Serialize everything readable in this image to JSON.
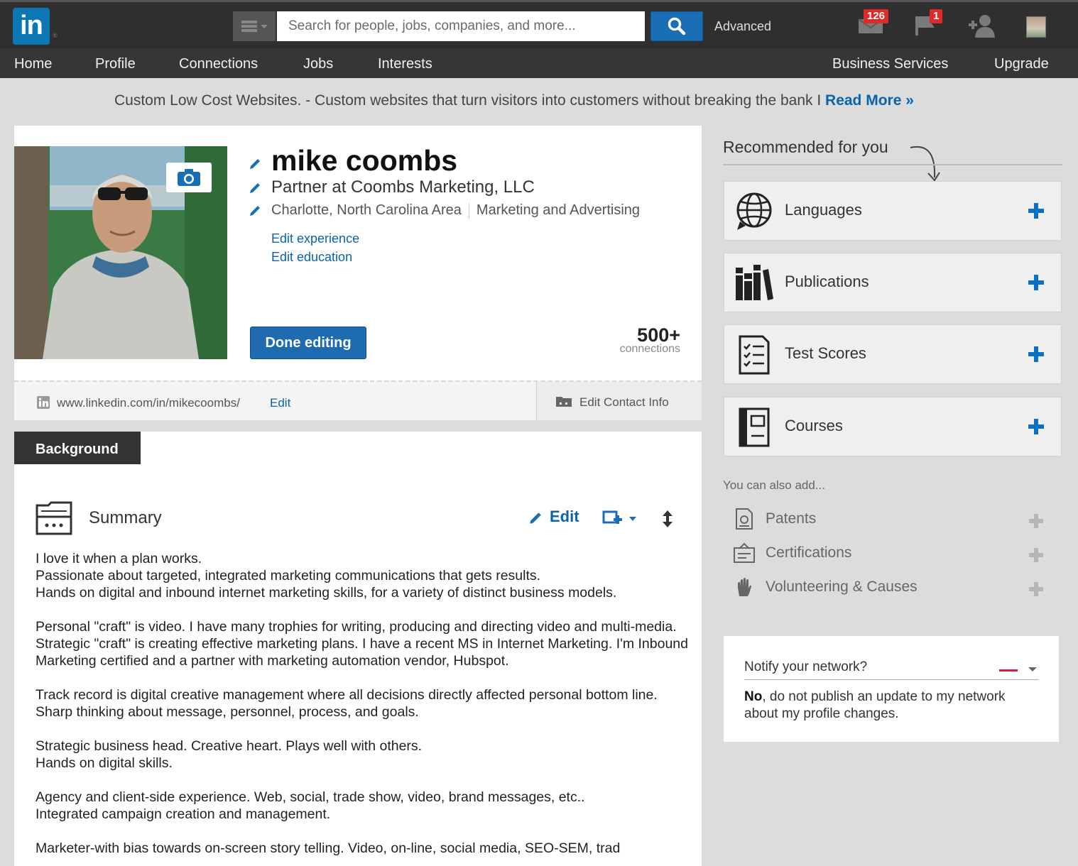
{
  "topbar": {
    "logo_text": "in",
    "logo_tm": "®",
    "search_placeholder": "Search for people, jobs, companies, and more...",
    "advanced_label": "Advanced",
    "messages_badge": "126",
    "notifications_badge": "1"
  },
  "nav": {
    "items": [
      "Home",
      "Profile",
      "Connections",
      "Jobs",
      "Interests"
    ],
    "right_items": [
      "Business Services",
      "Upgrade"
    ]
  },
  "ad": {
    "text": "Custom Low Cost Websites. - Custom websites that turn visitors into customers without breaking the bank I ",
    "link": "Read More »"
  },
  "profile": {
    "name": "mike coombs",
    "headline": "Partner at Coombs Marketing, LLC",
    "location": "Charlotte, North Carolina Area",
    "industry": "Marketing and Advertising",
    "edit_experience": "Edit experience",
    "edit_education": "Edit education",
    "done_button": "Done editing",
    "connections_count": "500+",
    "connections_label": "connections",
    "public_url": "www.linkedin.com/in/mikecoombs/",
    "url_edit": "Edit",
    "edit_contact": "Edit Contact Info"
  },
  "background": {
    "tab_label": "Background",
    "summary_title": "Summary",
    "summary_edit": "Edit",
    "paragraphs": [
      "I love it when a plan works.\nPassionate about targeted, integrated marketing communications that gets results.\nHands on digital and inbound internet marketing skills, for a variety of distinct business models.",
      "Personal \"craft\" is video. I have many trophies for writing, producing and directing video and multi-media. Strategic \"craft\" is creating effective marketing plans. I have a recent MS in Internet Marketing. I'm Inbound Marketing certified and a partner with marketing automation vendor, Hubspot.",
      "Track record is digital creative management where all decisions directly affected personal bottom line. Sharp thinking about message, personnel, process, and goals.",
      "Strategic business head. Creative heart. Plays well with others.\nHands on digital skills.",
      "Agency and client-side experience. Web, social, trade show, video, brand messages, etc..\nIntegrated campaign creation and management.",
      "Marketer-with bias towards on-screen story telling. Video, on-line, social media, SEO-SEM, trad"
    ]
  },
  "recommended": {
    "title": "Recommended for you",
    "cards": [
      {
        "label": "Languages",
        "icon": "globe-icon"
      },
      {
        "label": "Publications",
        "icon": "books-icon"
      },
      {
        "label": "Test Scores",
        "icon": "checklist-icon"
      },
      {
        "label": "Courses",
        "icon": "notebook-icon"
      }
    ],
    "also_label": "You can also add...",
    "also_items": [
      {
        "label": "Patents",
        "icon": "patent-icon"
      },
      {
        "label": "Certifications",
        "icon": "certificate-icon"
      },
      {
        "label": "Volunteering & Causes",
        "icon": "hand-icon"
      }
    ]
  },
  "notify": {
    "label": "Notify your network?",
    "answer_bold": "No",
    "answer_rest": ", do not publish an update to my network about my profile changes."
  },
  "colors": {
    "brand_blue": "#0b77b5",
    "link_blue": "#0b63ad",
    "badge_red": "#e02a2a",
    "topbar": "#2f2f2f"
  }
}
